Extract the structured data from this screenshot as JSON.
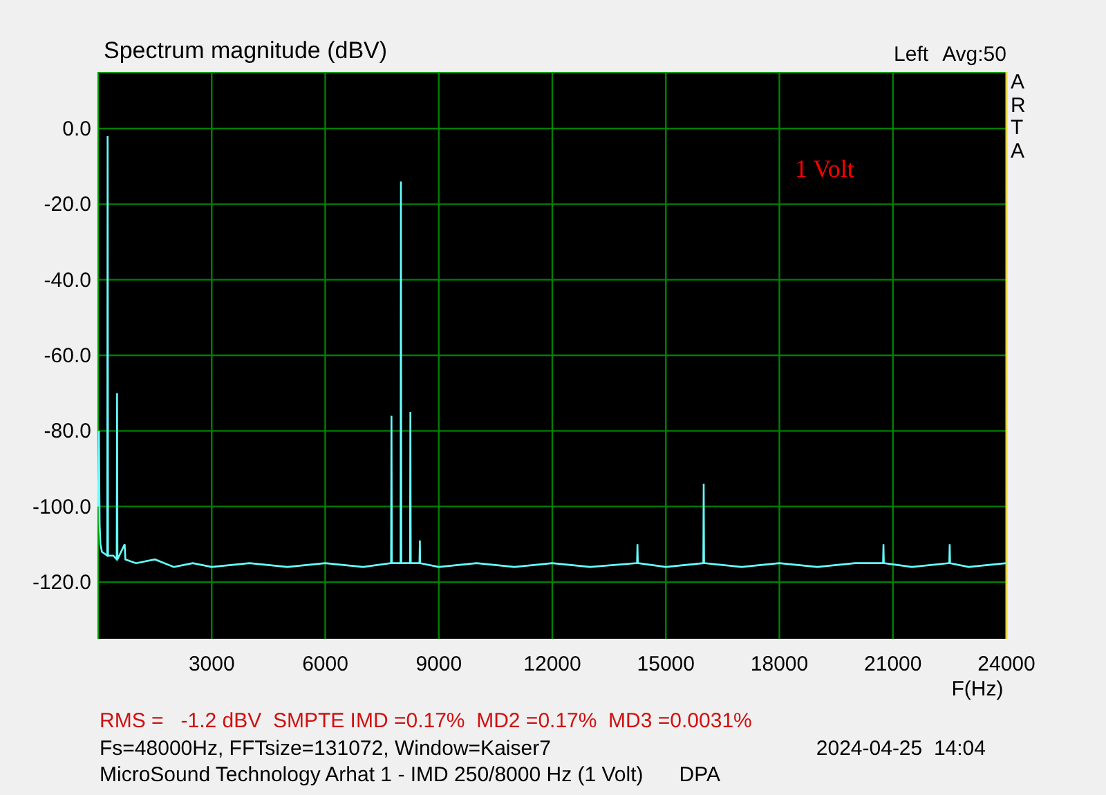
{
  "chart": {
    "averaging": "Avg:50",
    "brand": "ARTA",
    "annotation": "1 Volt",
    "chart_data": {
      "type": "line",
      "grid": true,
      "title": "Spectrum magnitude (dBV)",
      "xlabel": "F(Hz)",
      "xlim": [
        0,
        24000
      ],
      "ylim": [
        -135,
        15
      ],
      "xticks": [
        3000,
        6000,
        9000,
        12000,
        15000,
        18000,
        21000,
        24000
      ],
      "yticks": [
        {
          "value": 0,
          "label": "0.0"
        },
        {
          "value": -20,
          "label": "-20.0"
        },
        {
          "value": -40,
          "label": "-40.0"
        },
        {
          "value": -60,
          "label": "-60.0"
        },
        {
          "value": -80,
          "label": "-80.0"
        },
        {
          "value": -100,
          "label": "-100.0"
        },
        {
          "value": -120,
          "label": "-120.0"
        }
      ],
      "x": [
        0,
        20,
        40,
        60,
        100,
        240,
        250,
        260,
        400,
        490,
        500,
        510,
        700,
        720,
        1000,
        1500,
        2000,
        2500,
        3000,
        4000,
        5000,
        6000,
        7000,
        7740,
        7750,
        7760,
        7990,
        8000,
        8010,
        8240,
        8250,
        8260,
        8490,
        8500,
        8510,
        9000,
        10000,
        11000,
        12000,
        13000,
        14240,
        14250,
        14260,
        15000,
        15990,
        16000,
        16010,
        17000,
        18000,
        19000,
        20000,
        20740,
        20750,
        20760,
        21500,
        22490,
        22500,
        22510,
        23000,
        24000
      ],
      "series": [
        {
          "name": "Left",
          "color": "#66ffff",
          "values": [
            -100,
            -80,
            -105,
            -110,
            -112,
            -113,
            -2,
            -113,
            -113,
            -114,
            -70,
            -114,
            -110,
            -114,
            -115,
            -114,
            -116,
            -115,
            -116,
            -115,
            -116,
            -115,
            -116,
            -115,
            -76,
            -115,
            -115,
            -14,
            -115,
            -115,
            -75,
            -115,
            -115,
            -109,
            -115,
            -116,
            -115,
            -116,
            -115,
            -116,
            -115,
            -110,
            -115,
            -116,
            -115,
            -94,
            -115,
            -116,
            -115,
            -116,
            -115,
            -115,
            -110,
            -115,
            -116,
            -115,
            -110,
            -115,
            -116,
            -115
          ]
        }
      ]
    }
  },
  "results": "RMS =   -1.2 dBV  SMPTE IMD =0.17%  MD2 =0.17%  MD3 =0.0031%",
  "settings": "Fs=48000Hz, FFTsize=131072, Window=Kaiser7",
  "timestamp": "2024-04-25  14:04",
  "description": "MicroSound Technology Arhat 1 - IMD 250/8000 Hz (1 Volt)",
  "author": "DPA"
}
